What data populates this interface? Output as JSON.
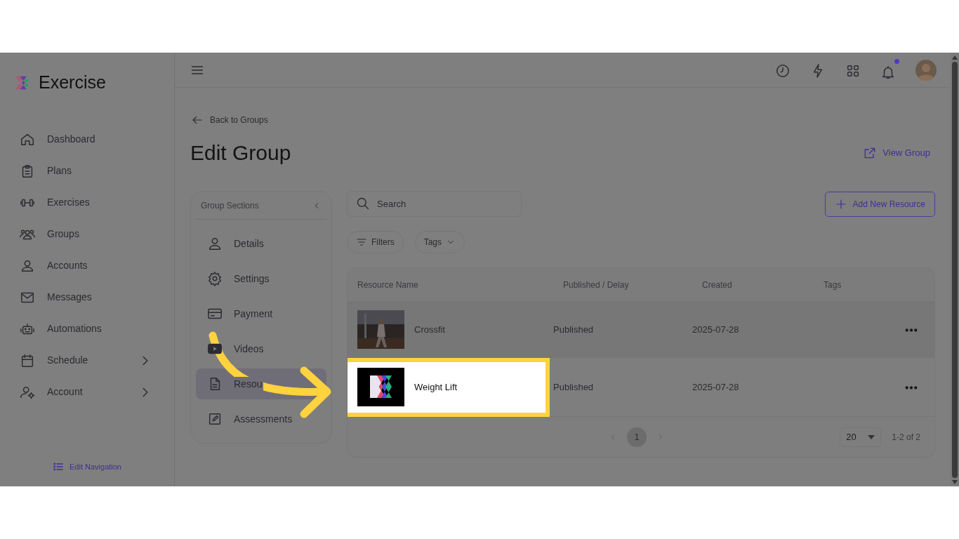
{
  "app": {
    "name": "Exercise"
  },
  "sidebar": {
    "items": [
      {
        "label": "Dashboard",
        "expandable": false
      },
      {
        "label": "Plans",
        "expandable": false
      },
      {
        "label": "Exercises",
        "expandable": false
      },
      {
        "label": "Groups",
        "expandable": false
      },
      {
        "label": "Accounts",
        "expandable": false
      },
      {
        "label": "Messages",
        "expandable": false
      },
      {
        "label": "Automations",
        "expandable": false
      },
      {
        "label": "Schedule",
        "expandable": true
      },
      {
        "label": "Account",
        "expandable": true
      }
    ],
    "footer": "Edit Navigation"
  },
  "header": {
    "notification_dot": true
  },
  "back_link": "Back to Groups",
  "title": "Edit Group",
  "view_link": "View Group",
  "sections": {
    "title": "Group Sections",
    "items": [
      {
        "label": "Details",
        "selected": false
      },
      {
        "label": "Settings",
        "selected": false
      },
      {
        "label": "Payment",
        "selected": false
      },
      {
        "label": "Videos",
        "selected": false
      },
      {
        "label": "Resou",
        "selected": true
      },
      {
        "label": "Assessments",
        "selected": false
      }
    ]
  },
  "search": {
    "placeholder": "Search"
  },
  "filters": [
    {
      "label": "Filters",
      "kind": "filter"
    },
    {
      "label": "Tags",
      "kind": "dropdown"
    }
  ],
  "add_button": "Add New Resource",
  "table": {
    "columns": [
      "Resource Name",
      "Published / Delay",
      "Created",
      "Tags"
    ],
    "rows": [
      {
        "name": "Crossfit",
        "kind": "picture",
        "status": "Published",
        "created": "2025-07-28",
        "highlighted": false
      },
      {
        "name": "Weight Lift",
        "kind": "logo",
        "status": "Published",
        "created": "2025-07-28",
        "highlighted": true
      }
    ]
  },
  "pagination": {
    "pages": [
      {
        "label": "1",
        "selected": true
      }
    ],
    "page_size": "20",
    "range": "1-2 of 2"
  }
}
